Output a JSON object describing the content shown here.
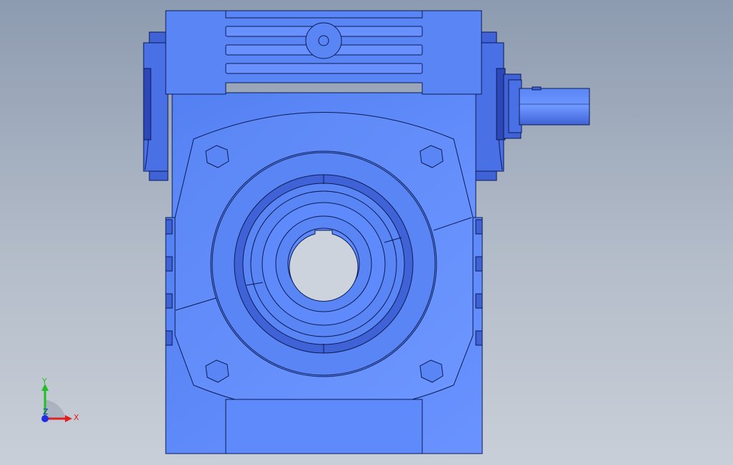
{
  "viewport": {
    "background_top": "#8d9bb0",
    "background_bottom": "#c9cfd8"
  },
  "model": {
    "body_color": "#5a86f5",
    "shade_color": "#3f62d6",
    "dark_color": "#2d47b8",
    "edge_color": "#0b1a55",
    "highlight_color": "#7aa2ff"
  },
  "triad": {
    "x_label": "X",
    "y_label": "Y",
    "z_label": "Z",
    "x_color": "#e02020",
    "y_color": "#20c020",
    "z_color": "#2030e0"
  }
}
